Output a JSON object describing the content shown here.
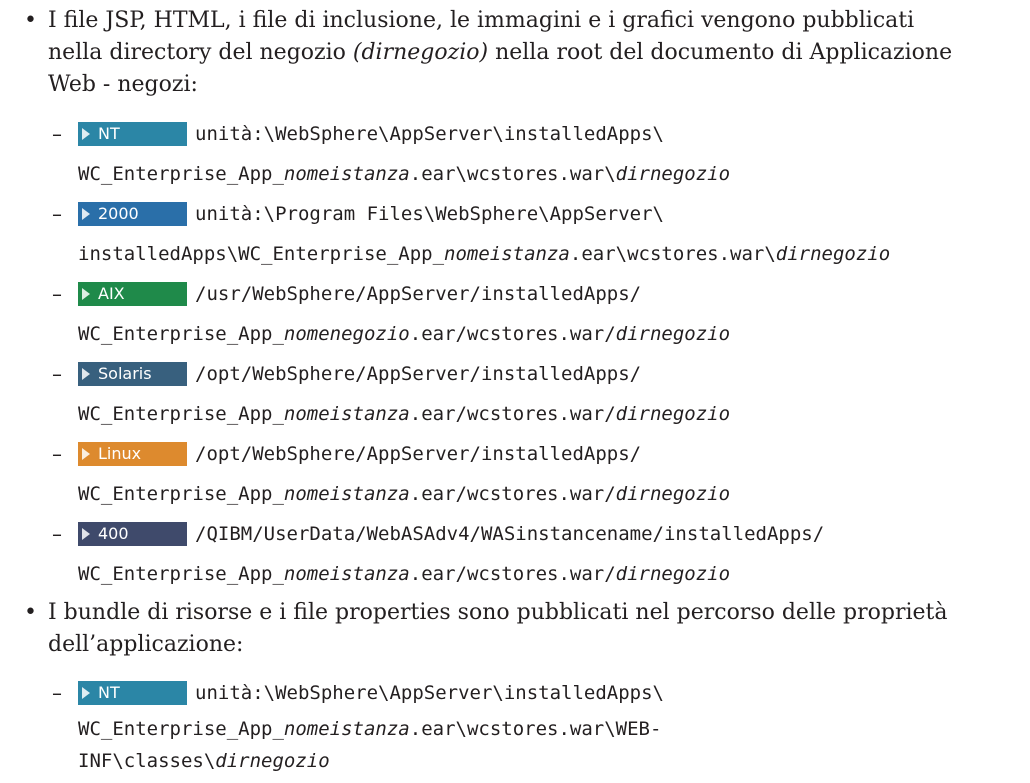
{
  "colors": {
    "nt": "#2b86a6",
    "w2000": "#2a6fa9",
    "aix": "#1f8a4a",
    "solaris": "#38607e",
    "linux": "#dd8a2e",
    "os400": "#3f4a6b"
  },
  "sections": [
    {
      "bullet": "•",
      "text_line1": "I file JSP, HTML, i file di inclusione, le immagini e i grafici vengono pubblicati",
      "text_line2_a": "nella directory del negozio ",
      "text_line2_em": "(dirnegozio)",
      "text_line2_b": " nella root del documento di Applicazione",
      "text_line3": "Web - negozi:",
      "items": [
        {
          "dash": "–",
          "badge": "NT",
          "badge_icon": "triangle-right-icon",
          "l1": "unità:\\WebSphere\\AppServer\\installedApps\\",
          "l2a": "WC_Enterprise_App_",
          "l2b": "nomeistanza",
          "l2c": ".ear\\wcstores.war\\",
          "l2d": "dirnegozio"
        },
        {
          "dash": "–",
          "badge": "2000",
          "badge_icon": "triangle-right-icon",
          "l1": "unità:\\Program Files\\WebSphere\\AppServer\\",
          "l2a": "installedApps\\WC_Enterprise_App_",
          "l2b": "nomeistanza",
          "l2c": ".ear\\wcstores.war\\",
          "l2d": "dirnegozio"
        },
        {
          "dash": "–",
          "badge": "AIX",
          "badge_icon": "triangle-right-icon",
          "l1": "/usr/WebSphere/AppServer/installedApps/",
          "l2a": "WC_Enterprise_App_",
          "l2b": "nomenegozio",
          "l2c": ".ear/wcstores.war/",
          "l2d": "dirnegozio"
        },
        {
          "dash": "–",
          "badge": "Solaris",
          "badge_icon": "triangle-right-icon",
          "l1": "/opt/WebSphere/AppServer/installedApps/",
          "l2a": "WC_Enterprise_App_",
          "l2b": "nomeistanza",
          "l2c": ".ear/wcstores.war/",
          "l2d": "dirnegozio"
        },
        {
          "dash": "–",
          "badge": "Linux",
          "badge_icon": "triangle-right-icon",
          "l1": "/opt/WebSphere/AppServer/installedApps/",
          "l2a": "WC_Enterprise_App_",
          "l2b": "nomeistanza",
          "l2c": ".ear/wcstores.war/",
          "l2d": "dirnegozio"
        },
        {
          "dash": "–",
          "badge": "400",
          "badge_icon": "triangle-right-icon",
          "l1": "/QIBM/UserData/WebASAdv4/WASinstancename/installedApps/",
          "l2a": "WC_Enterprise_App_",
          "l2b": "nomeistanza",
          "l2c": ".ear/wcstores.war/",
          "l2d": "dirnegozio"
        }
      ]
    },
    {
      "bullet": "•",
      "text_line1": "I bundle di risorse e i file properties sono pubblicati nel percorso delle proprietà",
      "text_line2": "dell’applicazione:",
      "items": [
        {
          "dash": "–",
          "badge": "NT",
          "badge_icon": "triangle-right-icon",
          "l1": "unità:\\WebSphere\\AppServer\\installedApps\\",
          "l2a": "WC_Enterprise_App_",
          "l2b": "nomeistanza",
          "l2c": ".ear\\wcstores.war\\WEB-",
          "l3a": "INF\\classes\\",
          "l3b": "dirnegozio"
        }
      ]
    }
  ]
}
